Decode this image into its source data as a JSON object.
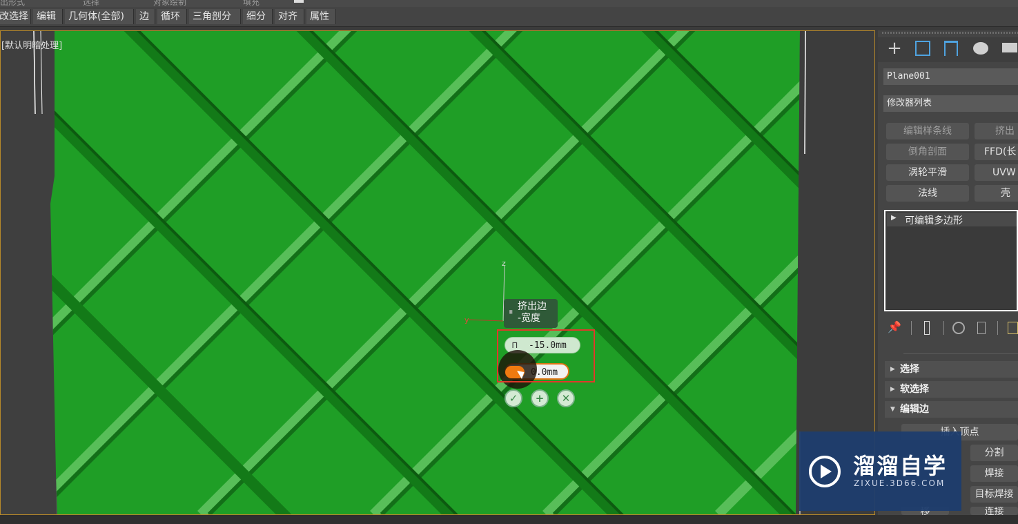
{
  "top_strip": [
    "出形式",
    "选择",
    "对象绘制",
    "填充"
  ],
  "ribbon": {
    "items": [
      "改选择",
      "编辑",
      "几何体(全部)",
      "边",
      "循环",
      "三角剖分",
      "细分",
      "对齐",
      "属性"
    ]
  },
  "viewport": {
    "label": "[默认明暗处理]",
    "gizmo_axes": {
      "z": "z",
      "y": "y"
    }
  },
  "caddy": {
    "title_line1": "挤出边",
    "title_line2": "-宽度",
    "height_value": "-15.0mm",
    "width_value": "0.0mm",
    "buttons": [
      "ok-icon",
      "apply-icon",
      "cancel-icon"
    ]
  },
  "command_panel": {
    "tab_icons": [
      "create-icon",
      "modify-icon",
      "hierarchy-icon",
      "motion-icon",
      "display-icon"
    ],
    "object_name": "Plane001",
    "modifier_list": "修改器列表",
    "modifier_buttons": [
      {
        "label": "编辑样条线",
        "active": false
      },
      {
        "label": "挤出",
        "active": false
      },
      {
        "label": "倒角剖面",
        "active": false
      },
      {
        "label": "FFD(长",
        "active": true
      },
      {
        "label": "涡轮平滑",
        "active": true
      },
      {
        "label": "UVW 贴",
        "active": true
      },
      {
        "label": "法线",
        "active": true
      },
      {
        "label": "壳",
        "active": true
      }
    ],
    "stack_item": "可编辑多边形",
    "stack_tool_icons": [
      "pin-stack-icon",
      "show-end-result-icon",
      "make-unique-icon",
      "remove-modifier-icon",
      "configure-icon"
    ],
    "rollouts": [
      {
        "label": "选择",
        "expanded": false
      },
      {
        "label": "软选择",
        "expanded": false
      },
      {
        "label": "编辑边",
        "expanded": true
      }
    ],
    "edit_edges": {
      "insert_vertex": "插入顶点",
      "split": "分割",
      "weld": "焊接",
      "target_weld": "目标焊接",
      "bottom_left": "移",
      "bottom_right": "连接"
    }
  },
  "watermark": {
    "name": "溜溜自学",
    "url": "ZIXUE.3D66.COM"
  },
  "colors": {
    "surface_green": "#1f9e26",
    "selection_red": "#e0392b",
    "accent_orange": "#f07a10",
    "watermark_blue": "#1d3d6e"
  }
}
